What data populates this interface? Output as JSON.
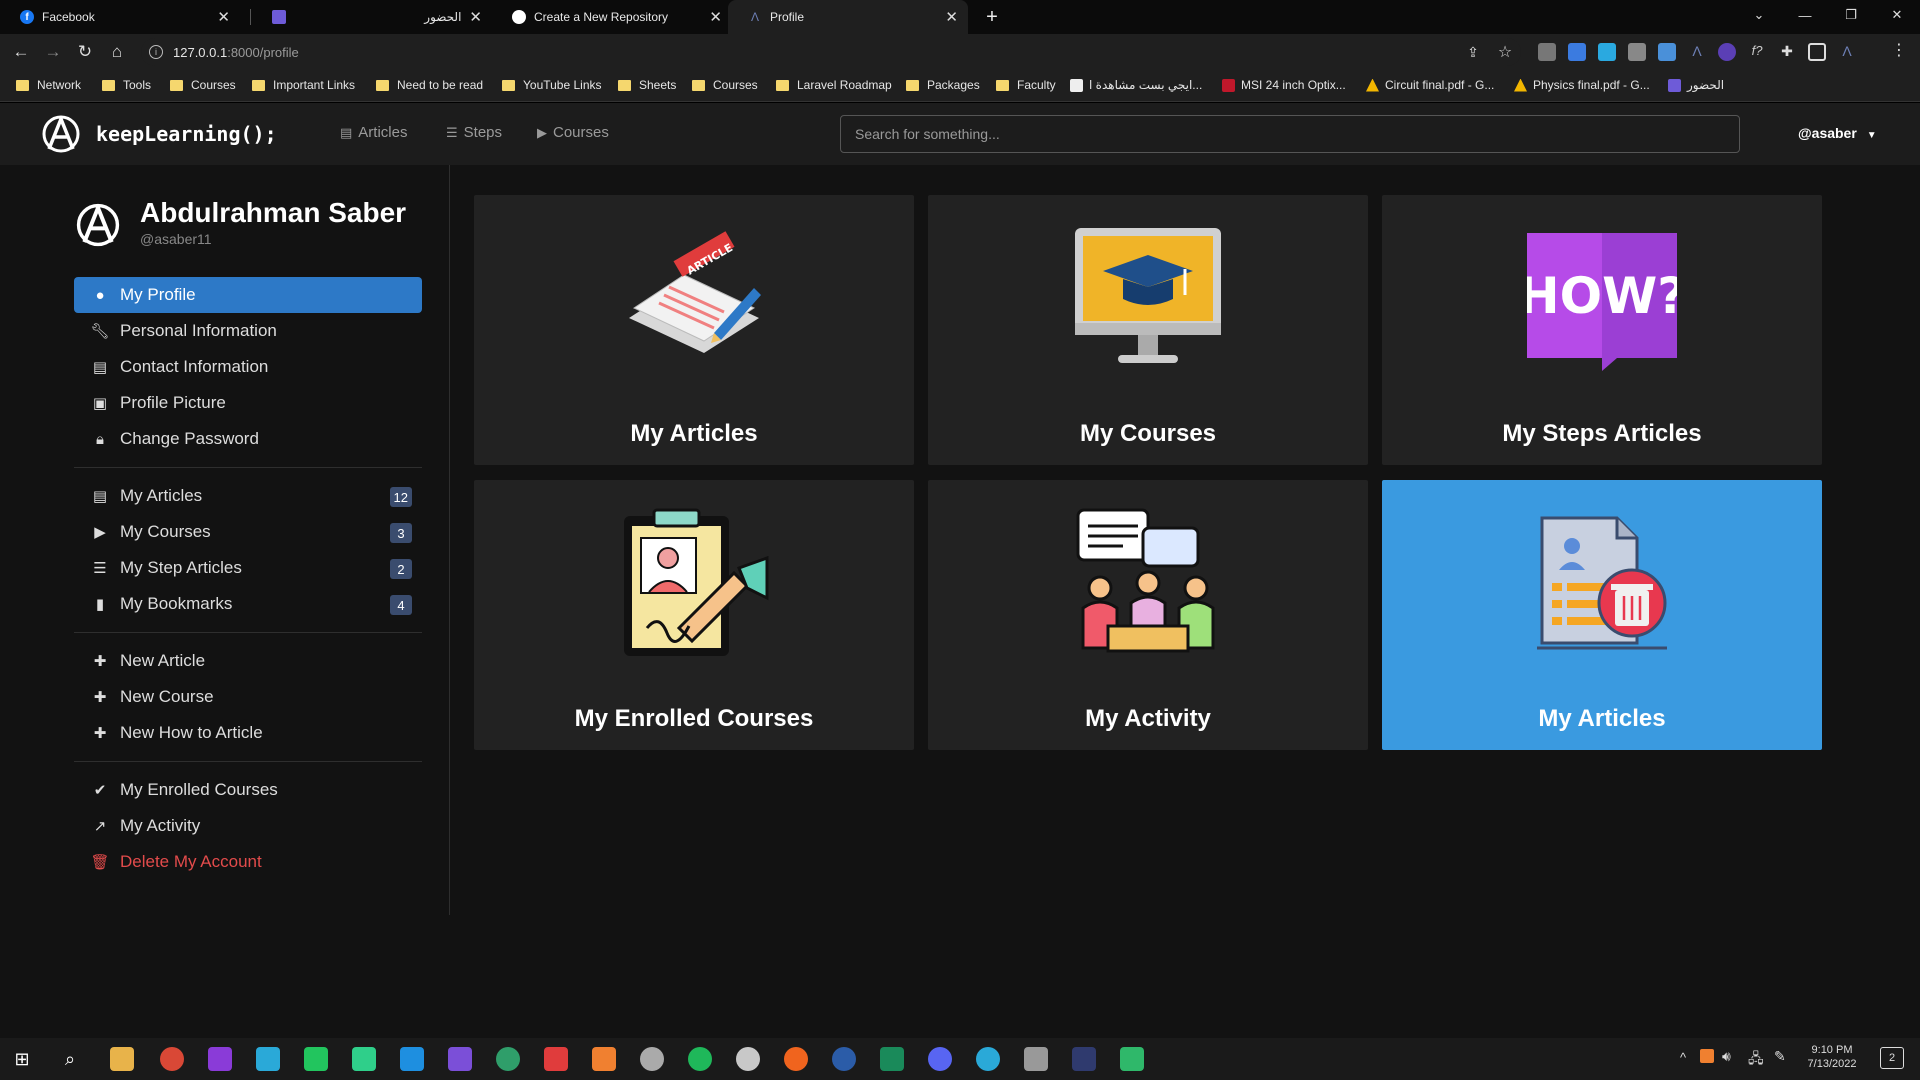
{
  "browser": {
    "tabs": [
      {
        "title": "Facebook",
        "favicon_color": "#1877f2"
      },
      {
        "title": "الحضور",
        "favicon_color": "#6e5bd8"
      },
      {
        "title": "Create a New Repository",
        "favicon_color": "#ffffff"
      },
      {
        "title": "Profile",
        "favicon_color": "#6d7fb5"
      }
    ],
    "new_tab": "+",
    "url_host": "127.0.0.1",
    "url_path": ":8000/profile",
    "bookmarks": [
      {
        "label": "Network",
        "type": "folder"
      },
      {
        "label": "Tools",
        "type": "folder"
      },
      {
        "label": "Courses",
        "type": "folder"
      },
      {
        "label": "Important Links",
        "type": "folder"
      },
      {
        "label": "Need to be read",
        "type": "folder"
      },
      {
        "label": "YouTube Links",
        "type": "folder"
      },
      {
        "label": "Sheets",
        "type": "folder"
      },
      {
        "label": "Courses",
        "type": "folder"
      },
      {
        "label": "Laravel Roadmap",
        "type": "folder"
      },
      {
        "label": "Packages",
        "type": "folder"
      },
      {
        "label": "Faculty",
        "type": "folder"
      },
      {
        "label": "ايجي بست مشاهدة ا...",
        "type": "site"
      },
      {
        "label": "MSI 24 inch Optix...",
        "type": "site"
      },
      {
        "label": "Circuit final.pdf - G...",
        "type": "site"
      },
      {
        "label": "Physics final.pdf - G...",
        "type": "site"
      },
      {
        "label": "الحضور",
        "type": "site"
      }
    ]
  },
  "site": {
    "brand": "keepLearning();",
    "nav": [
      {
        "label": "Articles",
        "icon": "newspaper-icon"
      },
      {
        "label": "Steps",
        "icon": "list-icon"
      },
      {
        "label": "Courses",
        "icon": "play-icon"
      }
    ],
    "search_placeholder": "Search for something...",
    "user": "@asaber"
  },
  "profile": {
    "name": "Abdulrahman Saber",
    "handle": "@asaber11"
  },
  "sidebar": {
    "account": [
      {
        "label": "My Profile",
        "icon": "user-icon",
        "active": true
      },
      {
        "label": "Personal Information",
        "icon": "wrench-icon"
      },
      {
        "label": "Contact Information",
        "icon": "id-card-icon"
      },
      {
        "label": "Profile Picture",
        "icon": "image-icon"
      },
      {
        "label": "Change Password",
        "icon": "lock-icon"
      }
    ],
    "content": [
      {
        "label": "My Articles",
        "icon": "newspaper-icon",
        "count": "12"
      },
      {
        "label": "My Courses",
        "icon": "play-icon",
        "count": "3"
      },
      {
        "label": "My Step Articles",
        "icon": "list-icon",
        "count": "2"
      },
      {
        "label": "My Bookmarks",
        "icon": "bookmark-icon",
        "count": "4"
      }
    ],
    "create": [
      {
        "label": "New Article",
        "icon": "plus-icon"
      },
      {
        "label": "New Course",
        "icon": "plus-icon"
      },
      {
        "label": "New How to Article",
        "icon": "plus-icon"
      }
    ],
    "other": [
      {
        "label": "My Enrolled Courses",
        "icon": "check-icon"
      },
      {
        "label": "My Activity",
        "icon": "chart-line-icon"
      },
      {
        "label": "Delete My Account",
        "icon": "trash-icon",
        "danger": true
      }
    ]
  },
  "cards": [
    {
      "label": "My Articles",
      "icon": "article-illustration-icon"
    },
    {
      "label": "My Courses",
      "icon": "graduation-monitor-icon"
    },
    {
      "label": "My Steps Articles",
      "icon": "how-question-icon"
    },
    {
      "label": "My Enrolled Courses",
      "icon": "clipboard-signing-icon"
    },
    {
      "label": "My Activity",
      "icon": "discussion-group-icon"
    },
    {
      "label": "My Articles",
      "icon": "document-delete-icon",
      "highlight": true
    }
  ],
  "taskbar": {
    "time": "9:10 PM",
    "date": "7/13/2022",
    "notifications": "2"
  },
  "colors": {
    "accent": "#2d79c7",
    "highlight_card": "#3a9ae0",
    "danger": "#e24b4b",
    "badge": "#3a4c6e"
  }
}
